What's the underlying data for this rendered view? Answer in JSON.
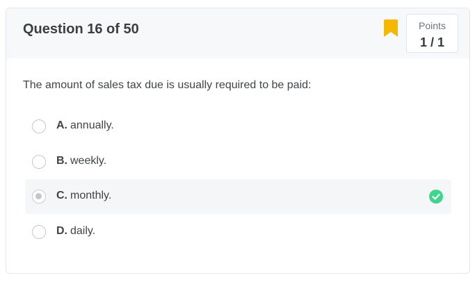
{
  "header": {
    "question_title": "Question 16 of 50",
    "points_label": "Points",
    "points_value": "1 / 1",
    "bookmark_color": "#f5b800"
  },
  "question": {
    "text": "The amount of sales tax due is usually required to be paid:"
  },
  "options": [
    {
      "letter": "A.",
      "text": "annually.",
      "selected": false,
      "correct": false
    },
    {
      "letter": "B.",
      "text": "weekly.",
      "selected": false,
      "correct": false
    },
    {
      "letter": "C.",
      "text": "monthly.",
      "selected": true,
      "correct": true
    },
    {
      "letter": "D.",
      "text": "daily.",
      "selected": false,
      "correct": false
    }
  ],
  "icons": {
    "bookmark": "bookmark-icon",
    "correct": "check-circle-icon"
  },
  "colors": {
    "correct": "#3dd68c",
    "header_bg": "#f7f8f9",
    "selected_bg": "#f5f6f7"
  }
}
